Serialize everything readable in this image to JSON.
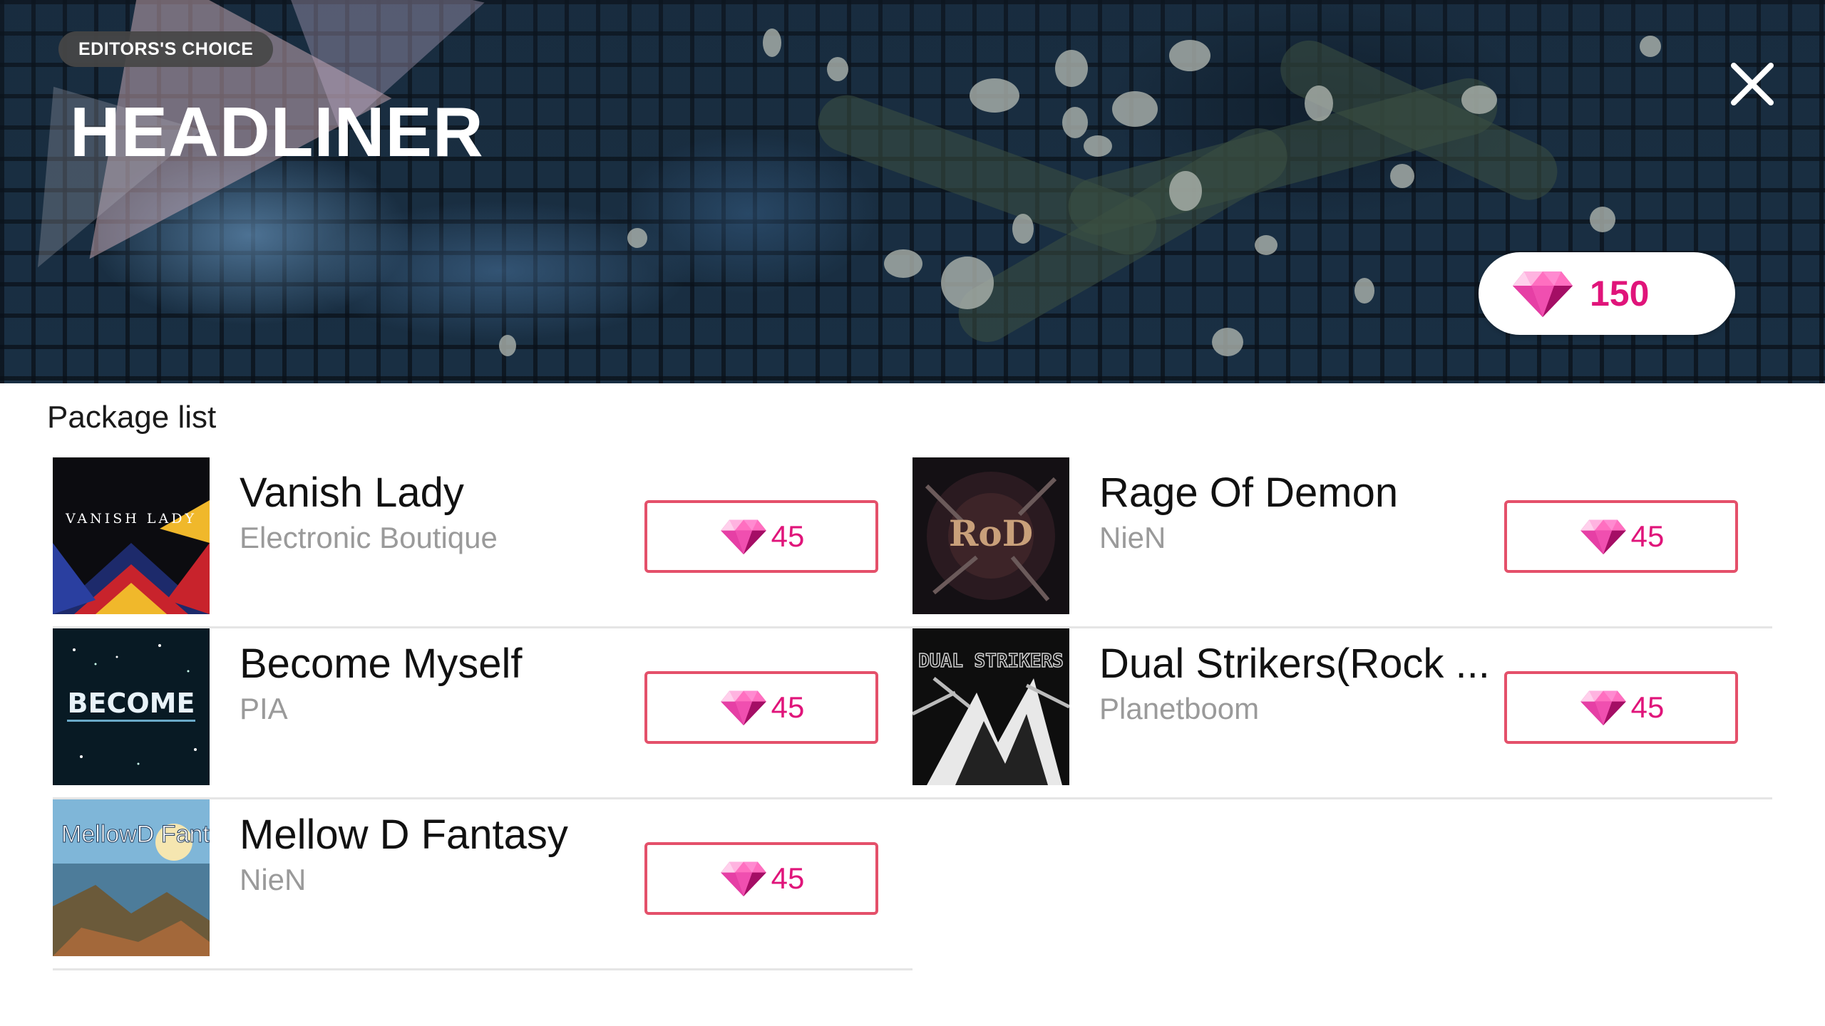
{
  "banner": {
    "badge": "EDITORS'S CHOICE",
    "title": "HEADLINER",
    "close_icon": "close-icon",
    "balance": "150",
    "balance_icon": "gem-icon"
  },
  "section_title": "Package list",
  "colors": {
    "accent": "#e0147a",
    "button_border": "#e4506a",
    "artist_text": "#9a9a9a"
  },
  "packages": [
    {
      "title": "Vanish Lady",
      "artist": "Electronic Boutique",
      "price": "45",
      "cover_text": "VANISH LADY"
    },
    {
      "title": "Rage Of Demon",
      "artist": "NieN",
      "price": "45",
      "cover_text": "RoD"
    },
    {
      "title": "Become Myself",
      "artist": "PIA",
      "price": "45",
      "cover_text": "BECOME"
    },
    {
      "title": "Dual Strikers(Rock ...",
      "artist": "Planetboom",
      "price": "45",
      "cover_text": "DUAL STRIKERS"
    },
    {
      "title": "Mellow D Fantasy",
      "artist": "NieN",
      "price": "45",
      "cover_text": "MellowD Fantasy"
    }
  ]
}
